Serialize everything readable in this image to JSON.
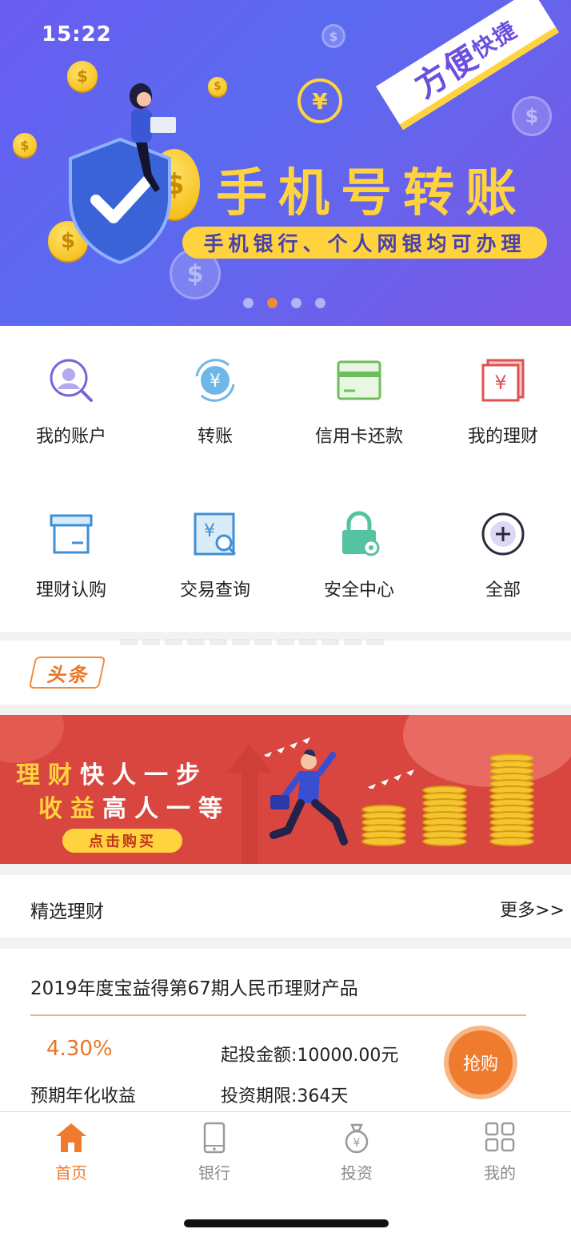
{
  "status_bar": {
    "time": "15:22"
  },
  "banner": {
    "badge": "方便",
    "badge_small": "快捷",
    "title": "手机号转账",
    "subtitle": "手机银行、个人网银均可办理",
    "active_dot": 1,
    "dot_count": 4
  },
  "shortcuts": [
    {
      "label": "我的账户",
      "icon": "account-search-icon"
    },
    {
      "label": "转账",
      "icon": "transfer-yen-icon"
    },
    {
      "label": "信用卡还款",
      "icon": "credit-card-icon"
    },
    {
      "label": "我的理财",
      "icon": "wealth-yen-icon"
    },
    {
      "label": "理财认购",
      "icon": "box-icon"
    },
    {
      "label": "交易查询",
      "icon": "transaction-search-icon"
    },
    {
      "label": "安全中心",
      "icon": "lock-gear-icon"
    },
    {
      "label": "全部",
      "icon": "plus-circle-icon"
    }
  ],
  "headline": {
    "tag": "头条"
  },
  "promo": {
    "line1_a": "理财",
    "line1_b": "快人一步",
    "line2_a": "收益",
    "line2_b": "高人一等",
    "button": "点击购买"
  },
  "featured": {
    "title": "精选理财",
    "more": "更多>>"
  },
  "product": {
    "name": "2019年度宝益得第67期人民币理财产品",
    "rate": "4.30%",
    "rate_label": "预期年化收益",
    "min_invest": "起投金额:10000.00元",
    "term": "投资期限:364天",
    "buy": "抢购"
  },
  "tabbar": [
    {
      "label": "首页",
      "icon": "home-icon",
      "active": true
    },
    {
      "label": "银行",
      "icon": "phone-icon",
      "active": false
    },
    {
      "label": "投资",
      "icon": "money-bag-icon",
      "active": false
    },
    {
      "label": "我的",
      "icon": "grid-icon",
      "active": false
    }
  ],
  "colors": {
    "accent": "#ef7b2e",
    "banner": "#6a5cf0",
    "promo": "#d9463f",
    "gold": "#ffd33d"
  }
}
